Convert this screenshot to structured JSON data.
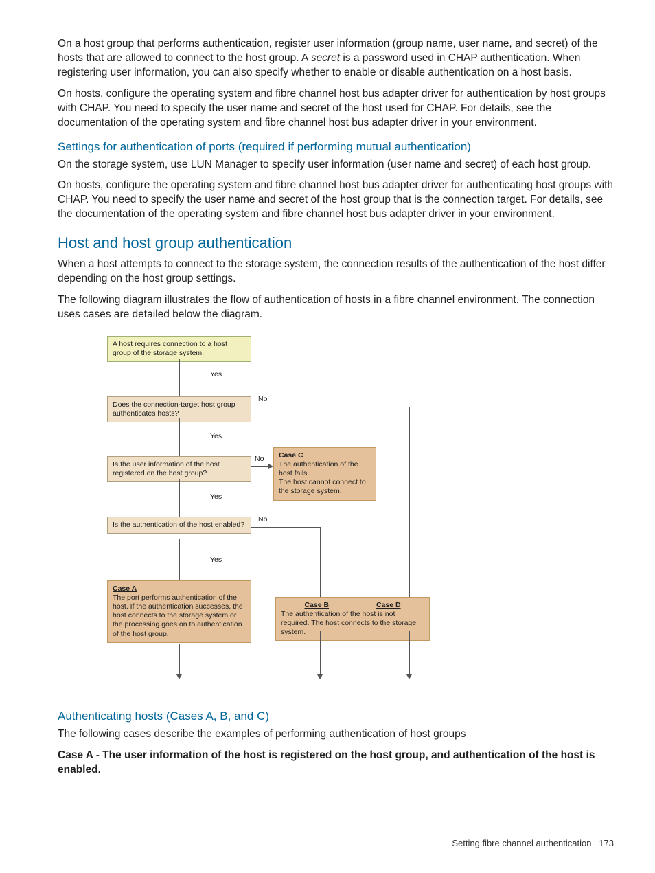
{
  "para1a": "On a host group that performs authentication, register user information (group name, user name, and secret) of the hosts that are allowed to connect to the host group. A ",
  "para1_italic": "secret",
  "para1b": " is a password used in CHAP authentication. When registering user information, you can also specify whether to enable or disable authentication on a host basis.",
  "para2": "On hosts, configure the operating system and fibre channel host bus adapter driver for authentication by host groups with CHAP. You need to specify the user name and secret of the host used for CHAP. For details, see the documentation of the operating system and fibre channel host bus adapter driver in your environment.",
  "h_settings_ports": "Settings for authentication of ports (required if performing mutual authentication)",
  "para3": "On the storage system, use LUN Manager to specify user information (user name and secret) of each host group.",
  "para4": "On hosts, configure the operating system and fibre channel host bus adapter driver for authenticating host groups with CHAP. You need to specify the user name and secret of the host group that is the connection target. For details, see the documentation of the operating system and fibre channel host bus adapter driver in your environment.",
  "h_hosthostgroup": "Host and host group authentication",
  "para5": "When a host attempts to connect to the storage system, the connection results of the authentication of the host differ depending on the host group settings.",
  "para6": "The following diagram illustrates the flow of authentication of hosts in a fibre channel environment. The connection uses cases are detailed below the diagram.",
  "flow": {
    "start": "A host requires connection to a host group of the storage system.",
    "yes": "Yes",
    "no": "No",
    "q1": "Does the connection-target host group authenticates hosts?",
    "q2": "Is the user information of the host registered on the host group?",
    "q3": "Is the authentication of the host enabled?",
    "caseA_lbl": "Case A",
    "caseA_txt": "The port performs authentication of the host. If the authentication successes, the host connects to the storage system or the processing goes on to authentication of the host group.",
    "caseB_lbl": "Case B",
    "caseD_lbl": "Case D",
    "caseBD_txt": "The authentication of the host is not required. The host connects to the storage system.",
    "caseC_lbl": "Case C",
    "caseC_txt": "The authentication of the host fails.\nThe host cannot connect to the storage system."
  },
  "h_auth_cases": "Authenticating hosts (Cases A, B, and C)",
  "para7": "The following cases describe the examples of performing authentication of host groups",
  "caseA_bold": "Case A - The user information of the host is registered on the host group, and authentication of the host is enabled.",
  "footer_text": "Setting fibre channel authentication",
  "footer_page": "173"
}
